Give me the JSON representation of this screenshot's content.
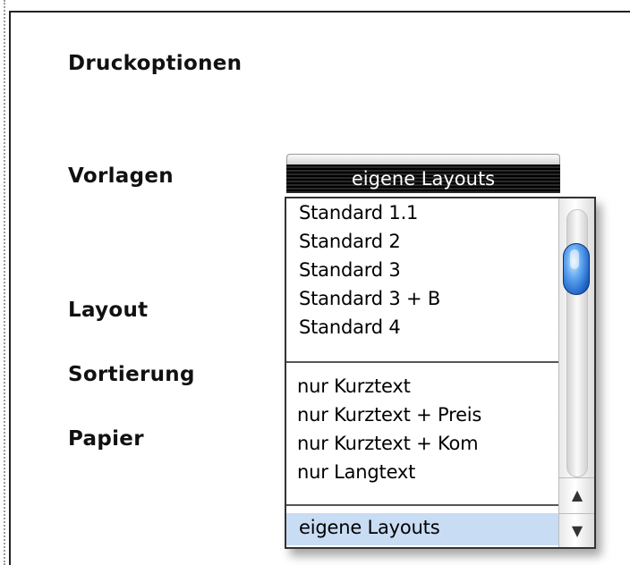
{
  "page": {
    "title": "Druckoptionen",
    "fields": {
      "vorlagen_label": "Vorlagen",
      "layout_label": "Layout",
      "sortierung_label": "Sortierung",
      "papier_label": "Papier"
    }
  },
  "select": {
    "current_value": "eigene Layouts"
  },
  "dropdown": {
    "group1": [
      "Standard 1.1",
      "Standard 2",
      "Standard 3",
      "Standard 3 + B",
      "Standard 4"
    ],
    "group2": [
      "nur Kurztext",
      "nur Kurztext + Preis",
      "nur Kurztext + Kom",
      "nur Langtext"
    ],
    "group3": [
      "eigene Layouts"
    ],
    "selected": "eigene Layouts"
  },
  "scrollbar": {
    "up_icon": "▲",
    "down_icon": "▼"
  },
  "colors": {
    "selection": "#c8dcf4",
    "select_bar": "#000000",
    "thumb": "#1e64c8"
  }
}
